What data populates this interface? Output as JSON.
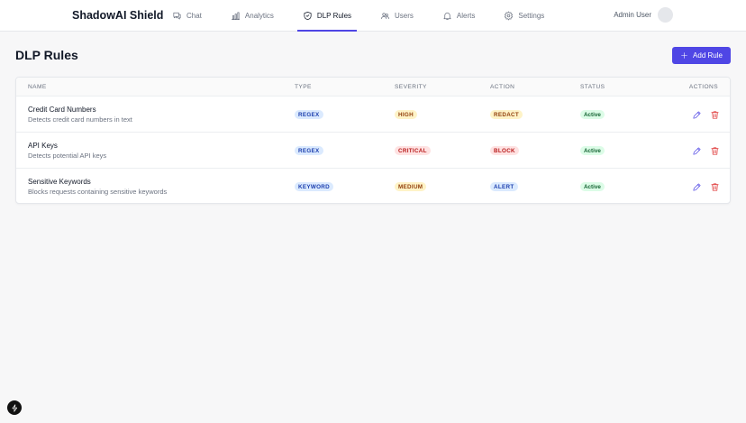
{
  "header": {
    "brand": "ShadowAI Shield",
    "nav": [
      {
        "label": "Chat",
        "icon": "chat-icon"
      },
      {
        "label": "Analytics",
        "icon": "bar-chart-icon"
      },
      {
        "label": "DLP Rules",
        "icon": "shield-icon",
        "active": true
      },
      {
        "label": "Users",
        "icon": "users-icon"
      },
      {
        "label": "Alerts",
        "icon": "bell-icon"
      },
      {
        "label": "Settings",
        "icon": "gear-icon"
      }
    ],
    "user_name": "Admin User"
  },
  "main": {
    "title": "DLP Rules",
    "add_button_label": "Add Rule",
    "table": {
      "columns": [
        "NAME",
        "TYPE",
        "SEVERITY",
        "ACTION",
        "STATUS",
        "ACTIONS"
      ],
      "rows": [
        {
          "name": "Credit Card Numbers",
          "description": "Detects credit card numbers in text",
          "type": "REGEX",
          "severity": "HIGH",
          "action": "REDACT",
          "status": "Active"
        },
        {
          "name": "API Keys",
          "description": "Detects potential API keys",
          "type": "REGEX",
          "severity": "CRITICAL",
          "action": "BLOCK",
          "status": "Active"
        },
        {
          "name": "Sensitive Keywords",
          "description": "Blocks requests containing sensitive keywords",
          "type": "KEYWORD",
          "severity": "MEDIUM",
          "action": "ALERT",
          "status": "Active"
        }
      ]
    }
  },
  "colors": {
    "accent": "#4f46e5",
    "danger": "#dc2626",
    "success": "#166534"
  }
}
